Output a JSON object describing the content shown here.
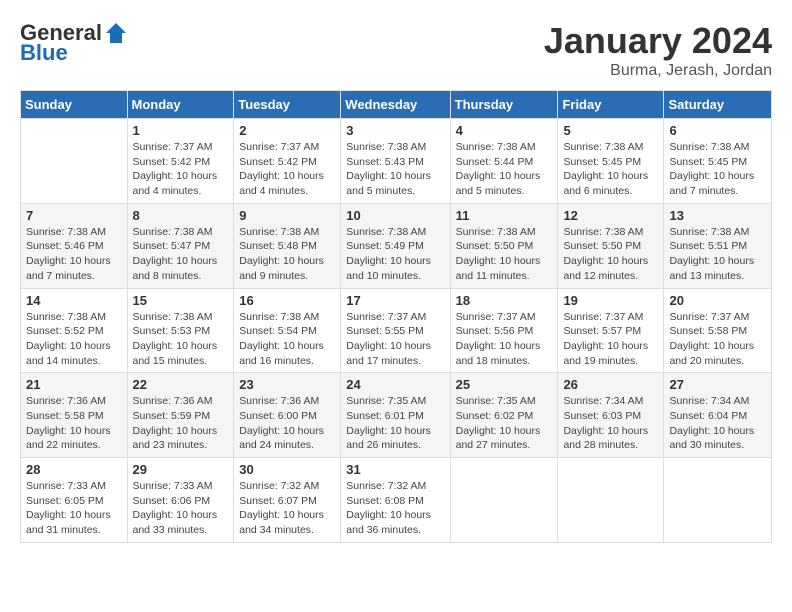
{
  "logo": {
    "general": "General",
    "blue": "Blue"
  },
  "title": "January 2024",
  "subtitle": "Burma, Jerash, Jordan",
  "headers": [
    "Sunday",
    "Monday",
    "Tuesday",
    "Wednesday",
    "Thursday",
    "Friday",
    "Saturday"
  ],
  "weeks": [
    [
      {
        "day": "",
        "info": ""
      },
      {
        "day": "1",
        "info": "Sunrise: 7:37 AM\nSunset: 5:42 PM\nDaylight: 10 hours\nand 4 minutes."
      },
      {
        "day": "2",
        "info": "Sunrise: 7:37 AM\nSunset: 5:42 PM\nDaylight: 10 hours\nand 4 minutes."
      },
      {
        "day": "3",
        "info": "Sunrise: 7:38 AM\nSunset: 5:43 PM\nDaylight: 10 hours\nand 5 minutes."
      },
      {
        "day": "4",
        "info": "Sunrise: 7:38 AM\nSunset: 5:44 PM\nDaylight: 10 hours\nand 5 minutes."
      },
      {
        "day": "5",
        "info": "Sunrise: 7:38 AM\nSunset: 5:45 PM\nDaylight: 10 hours\nand 6 minutes."
      },
      {
        "day": "6",
        "info": "Sunrise: 7:38 AM\nSunset: 5:45 PM\nDaylight: 10 hours\nand 7 minutes."
      }
    ],
    [
      {
        "day": "7",
        "info": "Sunrise: 7:38 AM\nSunset: 5:46 PM\nDaylight: 10 hours\nand 7 minutes."
      },
      {
        "day": "8",
        "info": "Sunrise: 7:38 AM\nSunset: 5:47 PM\nDaylight: 10 hours\nand 8 minutes."
      },
      {
        "day": "9",
        "info": "Sunrise: 7:38 AM\nSunset: 5:48 PM\nDaylight: 10 hours\nand 9 minutes."
      },
      {
        "day": "10",
        "info": "Sunrise: 7:38 AM\nSunset: 5:49 PM\nDaylight: 10 hours\nand 10 minutes."
      },
      {
        "day": "11",
        "info": "Sunrise: 7:38 AM\nSunset: 5:50 PM\nDaylight: 10 hours\nand 11 minutes."
      },
      {
        "day": "12",
        "info": "Sunrise: 7:38 AM\nSunset: 5:50 PM\nDaylight: 10 hours\nand 12 minutes."
      },
      {
        "day": "13",
        "info": "Sunrise: 7:38 AM\nSunset: 5:51 PM\nDaylight: 10 hours\nand 13 minutes."
      }
    ],
    [
      {
        "day": "14",
        "info": "Sunrise: 7:38 AM\nSunset: 5:52 PM\nDaylight: 10 hours\nand 14 minutes."
      },
      {
        "day": "15",
        "info": "Sunrise: 7:38 AM\nSunset: 5:53 PM\nDaylight: 10 hours\nand 15 minutes."
      },
      {
        "day": "16",
        "info": "Sunrise: 7:38 AM\nSunset: 5:54 PM\nDaylight: 10 hours\nand 16 minutes."
      },
      {
        "day": "17",
        "info": "Sunrise: 7:37 AM\nSunset: 5:55 PM\nDaylight: 10 hours\nand 17 minutes."
      },
      {
        "day": "18",
        "info": "Sunrise: 7:37 AM\nSunset: 5:56 PM\nDaylight: 10 hours\nand 18 minutes."
      },
      {
        "day": "19",
        "info": "Sunrise: 7:37 AM\nSunset: 5:57 PM\nDaylight: 10 hours\nand 19 minutes."
      },
      {
        "day": "20",
        "info": "Sunrise: 7:37 AM\nSunset: 5:58 PM\nDaylight: 10 hours\nand 20 minutes."
      }
    ],
    [
      {
        "day": "21",
        "info": "Sunrise: 7:36 AM\nSunset: 5:58 PM\nDaylight: 10 hours\nand 22 minutes."
      },
      {
        "day": "22",
        "info": "Sunrise: 7:36 AM\nSunset: 5:59 PM\nDaylight: 10 hours\nand 23 minutes."
      },
      {
        "day": "23",
        "info": "Sunrise: 7:36 AM\nSunset: 6:00 PM\nDaylight: 10 hours\nand 24 minutes."
      },
      {
        "day": "24",
        "info": "Sunrise: 7:35 AM\nSunset: 6:01 PM\nDaylight: 10 hours\nand 26 minutes."
      },
      {
        "day": "25",
        "info": "Sunrise: 7:35 AM\nSunset: 6:02 PM\nDaylight: 10 hours\nand 27 minutes."
      },
      {
        "day": "26",
        "info": "Sunrise: 7:34 AM\nSunset: 6:03 PM\nDaylight: 10 hours\nand 28 minutes."
      },
      {
        "day": "27",
        "info": "Sunrise: 7:34 AM\nSunset: 6:04 PM\nDaylight: 10 hours\nand 30 minutes."
      }
    ],
    [
      {
        "day": "28",
        "info": "Sunrise: 7:33 AM\nSunset: 6:05 PM\nDaylight: 10 hours\nand 31 minutes."
      },
      {
        "day": "29",
        "info": "Sunrise: 7:33 AM\nSunset: 6:06 PM\nDaylight: 10 hours\nand 33 minutes."
      },
      {
        "day": "30",
        "info": "Sunrise: 7:32 AM\nSunset: 6:07 PM\nDaylight: 10 hours\nand 34 minutes."
      },
      {
        "day": "31",
        "info": "Sunrise: 7:32 AM\nSunset: 6:08 PM\nDaylight: 10 hours\nand 36 minutes."
      },
      {
        "day": "",
        "info": ""
      },
      {
        "day": "",
        "info": ""
      },
      {
        "day": "",
        "info": ""
      }
    ]
  ]
}
